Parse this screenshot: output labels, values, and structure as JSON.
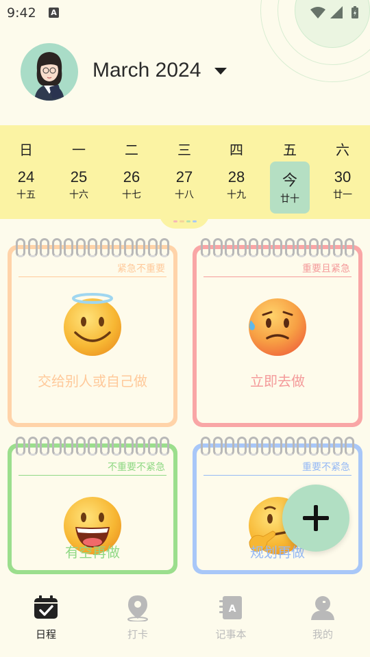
{
  "status_bar": {
    "time": "9:42",
    "notif_icon_letter": "A"
  },
  "header": {
    "month_label": "March 2024"
  },
  "week": {
    "weekdays": [
      "日",
      "一",
      "二",
      "三",
      "四",
      "五",
      "六"
    ],
    "dates": [
      {
        "day": "24",
        "lunar": "十五"
      },
      {
        "day": "25",
        "lunar": "十六"
      },
      {
        "day": "26",
        "lunar": "十七"
      },
      {
        "day": "27",
        "lunar": "十八"
      },
      {
        "day": "28",
        "lunar": "十九"
      },
      {
        "day": "今",
        "lunar": "廿十"
      },
      {
        "day": "30",
        "lunar": "廿一"
      }
    ],
    "selected_index": 5,
    "handle_colors": [
      "#f5b8b8",
      "#f5d49a",
      "#b7e3b1",
      "#a9c9f5"
    ]
  },
  "quadrants": [
    {
      "tag": "紧急不重要",
      "caption": "交给别人或自己做",
      "color": "#ffd3a9",
      "text_color": "#ffc99a",
      "face": "halo-smile-icon"
    },
    {
      "tag": "重要且紧急",
      "caption": "立即去做",
      "color": "#f9a6a6",
      "text_color": "#f49a9a",
      "face": "worried-sweat-icon"
    },
    {
      "tag": "不重要不紧急",
      "caption": "有空再做",
      "color": "#9bde8d",
      "text_color": "#8fd884",
      "face": "grin-icon"
    },
    {
      "tag": "重要不紧急",
      "caption": "规划再做",
      "color": "#a8c7f8",
      "text_color": "#95b9f5",
      "face": "thinking-icon"
    }
  ],
  "tabs": [
    {
      "label": "日程",
      "icon": "calendar-check-icon",
      "active": true
    },
    {
      "label": "打卡",
      "icon": "location-pin-icon",
      "active": false
    },
    {
      "label": "记事本",
      "icon": "notebook-icon",
      "active": false
    },
    {
      "label": "我的",
      "icon": "profile-icon",
      "active": false
    }
  ],
  "colors": {
    "background": "#fdfbec",
    "week_strip": "#fbf3a3",
    "today_highlight": "#b5dfc3",
    "fab": "#b1dfc3",
    "tab_active": "#222222",
    "tab_inactive": "#b9b9b9"
  }
}
